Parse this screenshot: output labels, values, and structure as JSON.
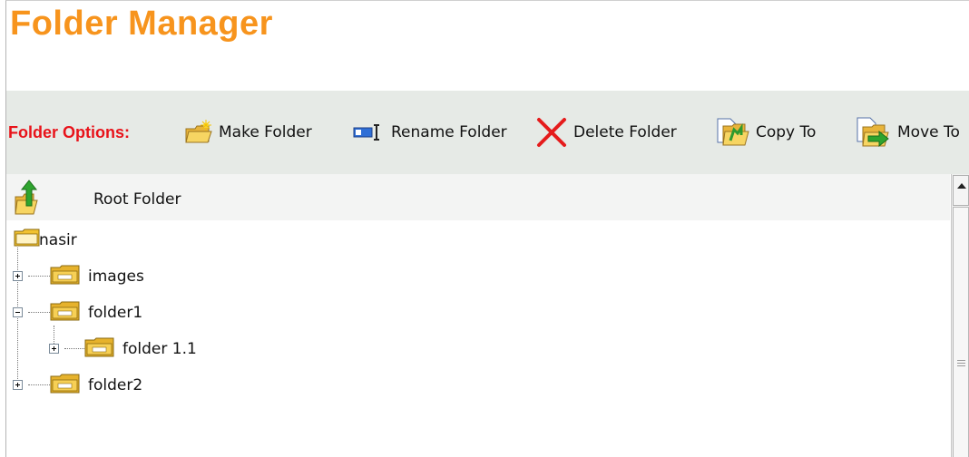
{
  "page": {
    "title": "Folder Manager"
  },
  "toolbar": {
    "label": "Folder Options:",
    "items": [
      {
        "label": "Make Folder",
        "icon": "new-folder-icon"
      },
      {
        "label": "Rename Folder",
        "icon": "rename-icon"
      },
      {
        "label": "Delete Folder",
        "icon": "delete-icon"
      },
      {
        "label": "Copy To",
        "icon": "copy-to-icon"
      },
      {
        "label": "Move To",
        "icon": "move-to-icon"
      }
    ]
  },
  "tree": {
    "root_label": "Root Folder",
    "nodes": [
      {
        "label": "nasir",
        "state": "open"
      },
      {
        "label": "images",
        "state": "collapsed"
      },
      {
        "label": "folder1",
        "state": "expanded"
      },
      {
        "label": "folder 1.1",
        "state": "collapsed"
      },
      {
        "label": "folder2",
        "state": "collapsed"
      }
    ]
  },
  "colors": {
    "title": "#f7941d",
    "toolbar_label": "#e8131a",
    "toolbar_bg": "#e6eae6",
    "folder": "#f2c230"
  }
}
